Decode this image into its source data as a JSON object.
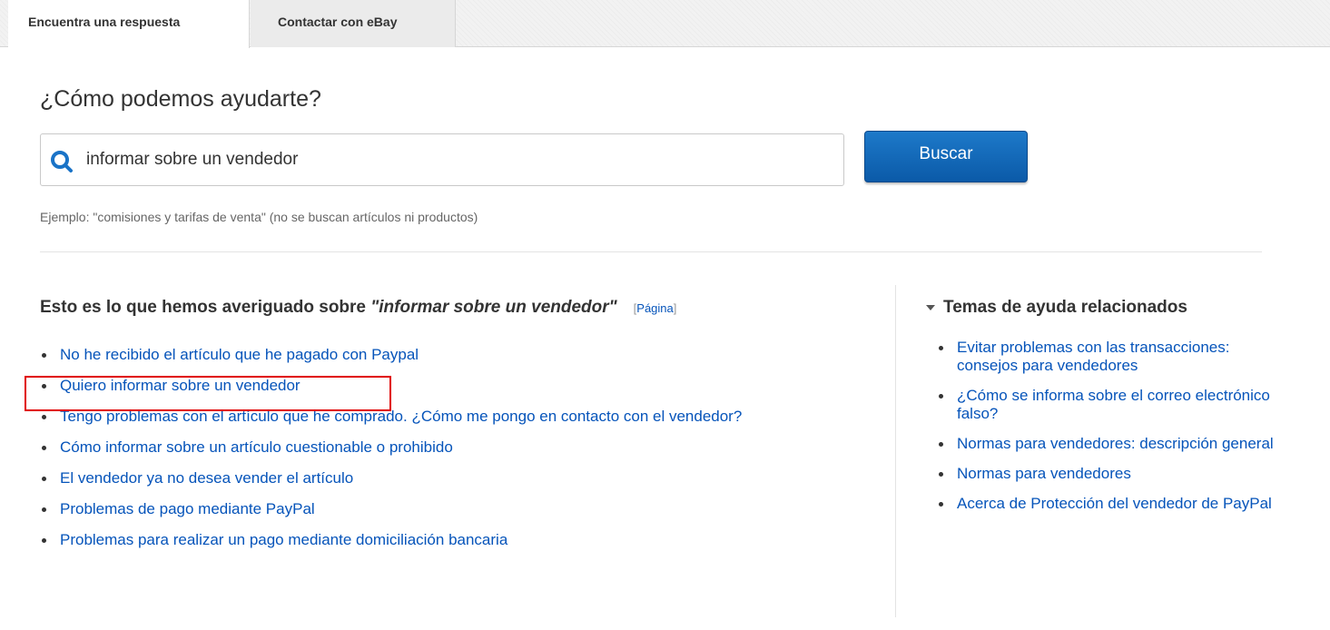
{
  "tabs": [
    {
      "label": "Encuentra una respuesta",
      "active": true
    },
    {
      "label": "Contactar con eBay",
      "active": false
    }
  ],
  "page_title": "¿Cómo podemos ayudarte?",
  "search": {
    "value": "informar sobre un vendedor",
    "icon": "search-icon",
    "button_label": "Buscar",
    "example": "Ejemplo: \"comisiones y tarifas de venta\" (no se buscan artículos ni productos)"
  },
  "results": {
    "heading_prefix": "Esto es lo que hemos averiguado sobre ",
    "heading_query": "\"informar sobre un vendedor\"",
    "page_link_open": "[",
    "page_link_label": "Página",
    "page_link_close": "]",
    "items": [
      "No he recibido el artículo que he pagado con Paypal",
      "Quiero informar sobre un vendedor",
      "Tengo problemas con el artículo que he comprado. ¿Cómo me pongo en contacto con el vendedor?",
      "Cómo informar sobre un artículo cuestionable o prohibido",
      "El vendedor ya no desea vender el artículo",
      "Problemas de pago mediante PayPal",
      "Problemas para realizar un pago mediante domiciliación bancaria"
    ]
  },
  "related": {
    "heading": "Temas de ayuda relacionados",
    "items": [
      "Evitar problemas con las transacciones: consejos para vendedores",
      "¿Cómo se informa sobre el correo electrónico falso?",
      "Normas para vendedores: descripción general",
      "Normas para vendedores",
      "Acerca de Protección del vendedor de PayPal"
    ]
  },
  "colors": {
    "link": "#0654ba",
    "button": "#0b5aa8",
    "highlight": "#e00000"
  }
}
